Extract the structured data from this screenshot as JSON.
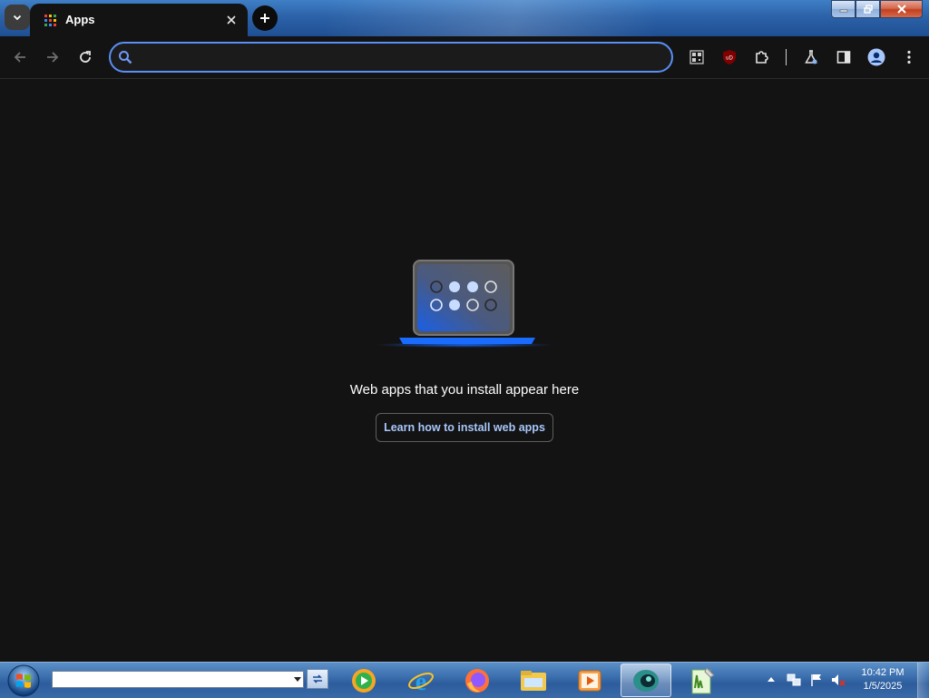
{
  "browser": {
    "tab_title": "Apps",
    "tab_icon": "apps-grid-icon",
    "omnibox": {
      "value": "",
      "placeholder": ""
    }
  },
  "toolbar": {
    "icons": [
      "back-icon",
      "forward-icon",
      "reload-icon",
      "qr-code-icon",
      "ublock-extension-icon",
      "extensions-puzzle-icon",
      "labs-flask-icon",
      "side-panel-icon",
      "profile-avatar-icon",
      "menu-icon"
    ],
    "extension_badge": "uD"
  },
  "content": {
    "message": "Web apps that you install appear here",
    "learn_button": "Learn how to install web apps"
  },
  "taskbar": {
    "address_value": "",
    "apps": [
      "windows-media-player-icon",
      "internet-explorer-icon",
      "firefox-icon",
      "file-explorer-icon",
      "media-player-icon",
      "chrome-dev-icon",
      "notepad-plus-plus-icon"
    ],
    "clock_time": "10:42 PM",
    "clock_date": "1/5/2025"
  },
  "colors": {
    "background": "#131313",
    "accent": "#a8c7fa",
    "omnibox_border": "#5a8ff5",
    "tab_strip": "#2c62a8"
  }
}
